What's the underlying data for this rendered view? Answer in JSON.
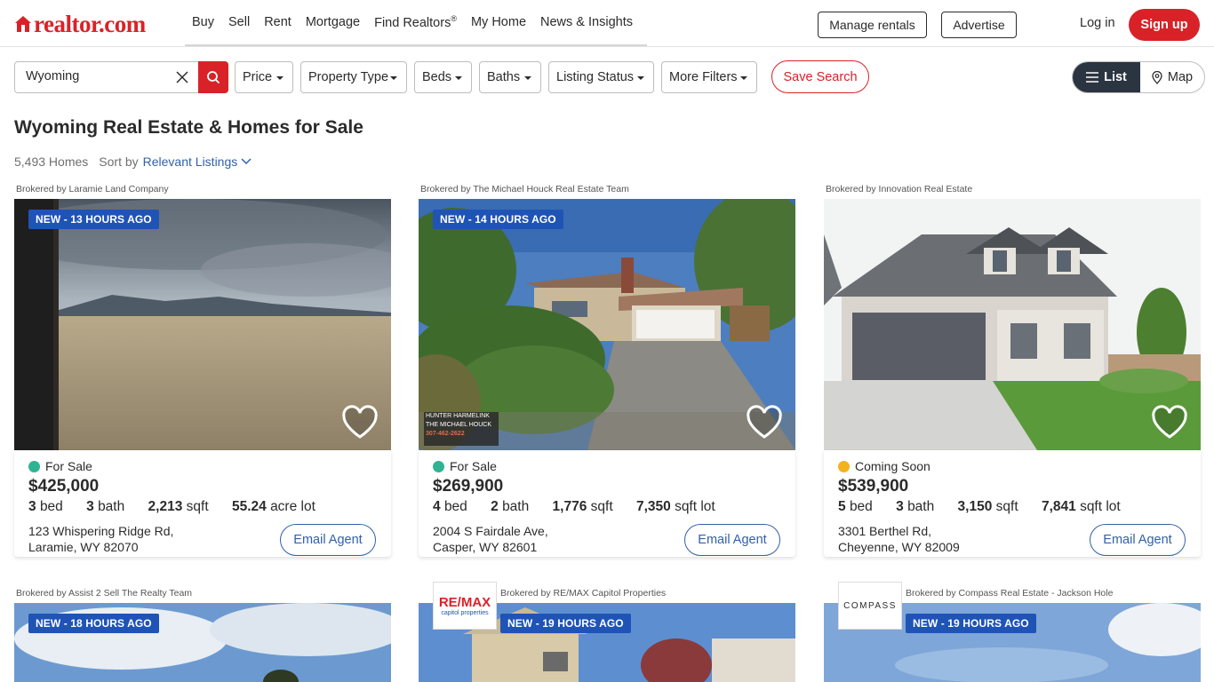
{
  "header": {
    "logo_text": "realtor.com",
    "nav": [
      "Buy",
      "Sell",
      "Rent",
      "Mortgage",
      "Find Realtors",
      "My Home",
      "News & Insights"
    ],
    "find_realtors_mark": "®",
    "manage_rentals": "Manage rentals",
    "advertise": "Advertise",
    "login": "Log in",
    "signup": "Sign up"
  },
  "filters": {
    "search_value": "Wyoming",
    "price": "Price",
    "property_type": "Property Type",
    "beds": "Beds",
    "baths": "Baths",
    "listing_status": "Listing Status",
    "more_filters": "More Filters",
    "save_search": "Save Search",
    "view_list": "List",
    "view_map": "Map"
  },
  "page": {
    "title": "Wyoming Real Estate & Homes for Sale",
    "count": "5,493 Homes",
    "sort_label": "Sort by",
    "sort_value": "Relevant Listings"
  },
  "colors": {
    "brand_red": "#d92228",
    "badge_blue": "#1f54b6",
    "link_blue": "#3161a9",
    "for_sale_dot": "#2eb393",
    "coming_soon_dot": "#f3b21e"
  },
  "listings": [
    {
      "broker": "Brokered by Laramie Land Company",
      "badge": "NEW - 13 HOURS AGO",
      "status": "For Sale",
      "status_color": "#2eb393",
      "price": "$425,000",
      "beds": "3",
      "beds_unit": "bed",
      "baths": "3",
      "baths_unit": "bath",
      "sqft": "2,213",
      "sqft_unit": "sqft",
      "lot": "55.24",
      "lot_unit": "acre lot",
      "address1": "123 Whispering Ridge Rd,",
      "address2": "Laramie, WY 82070",
      "email": "Email Agent"
    },
    {
      "broker": "Brokered by The Michael Houck Real Estate Team",
      "badge": "NEW - 14 HOURS AGO",
      "status": "For Sale",
      "status_color": "#2eb393",
      "price": "$269,900",
      "beds": "4",
      "beds_unit": "bed",
      "baths": "2",
      "baths_unit": "bath",
      "sqft": "1,776",
      "sqft_unit": "sqft",
      "lot": "7,350",
      "lot_unit": "sqft lot",
      "address1": "2004 S Fairdale Ave,",
      "address2": "Casper, WY 82601",
      "email": "Email Agent",
      "photo_sign_top": "HUNTER HARMELINK",
      "photo_sign_mid": "THE MICHAEL HOUCK",
      "photo_sign_phone": "307-462-2622"
    },
    {
      "broker": "Brokered by Innovation Real Estate",
      "badge": "",
      "status": "Coming Soon",
      "status_color": "#f3b21e",
      "price": "$539,900",
      "beds": "5",
      "beds_unit": "bed",
      "baths": "3",
      "baths_unit": "bath",
      "sqft": "3,150",
      "sqft_unit": "sqft",
      "lot": "7,841",
      "lot_unit": "sqft lot",
      "address1": "3301 Berthel Rd,",
      "address2": "Cheyenne, WY 82009",
      "email": "Email Agent"
    },
    {
      "broker": "Brokered by Assist 2 Sell The Realty Team",
      "badge": "NEW - 18 HOURS AGO"
    },
    {
      "broker": "Brokered by RE/MAX Capitol Properties",
      "badge": "NEW - 19 HOURS AGO",
      "brand_logo": "RE/MAX",
      "brand_logo_sub": "capitol properties"
    },
    {
      "broker": "Brokered by Compass Real Estate - Jackson Hole",
      "badge": "NEW - 19 HOURS AGO",
      "brand_logo": "COMPASS"
    }
  ]
}
